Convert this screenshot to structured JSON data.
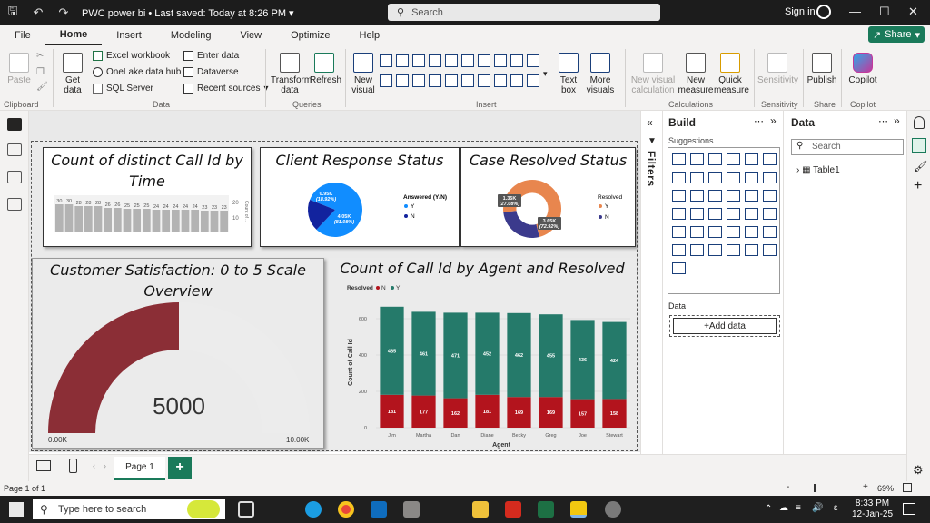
{
  "titlebar": {
    "app_title": "PWC power bi",
    "save_status": "Last saved: Today at 8:26 PM",
    "search_placeholder": "Search",
    "sign_in": "Sign in"
  },
  "menu": {
    "tabs": [
      "File",
      "Home",
      "Insert",
      "Modeling",
      "View",
      "Optimize",
      "Help"
    ],
    "active": "Home",
    "share_label": "Share"
  },
  "ribbon": {
    "paste": "Paste",
    "get_data": "Get data",
    "excel_workbook": "Excel workbook",
    "onelake": "OneLake data hub",
    "sql_server": "SQL Server",
    "enter_data": "Enter data",
    "dataverse": "Dataverse",
    "recent_sources": "Recent sources",
    "transform_data": "Transform data",
    "refresh": "Refresh",
    "new_visual": "New visual",
    "text_box": "Text box",
    "more_visuals": "More visuals",
    "new_visual_calc": "New visual calculation",
    "new_measure": "New measure",
    "quick_measure": "Quick measure",
    "sensitivity": "Sensitivity",
    "publish": "Publish",
    "copilot": "Copilot",
    "groups": {
      "clipboard": "Clipboard",
      "data": "Data",
      "queries": "Queries",
      "insert": "Insert",
      "calculations": "Calculations",
      "sensitivity": "Sensitivity",
      "share": "Share",
      "copilot": "Copilot"
    }
  },
  "visuals": {
    "time_chart": {
      "title": "Count of distinct Call Id by Time",
      "y_axis_label": "Count of ...",
      "y_max_label": "20",
      "y_min_label": "10"
    },
    "client_response": {
      "title": "Client Response Status",
      "legend_title": "Answered (Y/N)",
      "legend_items": [
        "Y",
        "N"
      ]
    },
    "case_resolved": {
      "title": "Case Resolved Status",
      "legend_title": "Resolved",
      "legend_items": [
        "Y",
        "N"
      ]
    },
    "satisfaction": {
      "title": "Customer Satisfaction: 0 to 5 Scale Overview",
      "value": "5000",
      "min_label": "0.00K",
      "max_label": "10.00K"
    },
    "agent_chart": {
      "title": "Count of Call Id by Agent and Resolved",
      "legend_title": "Resolved",
      "legend_items": [
        "N",
        "Y"
      ],
      "x_label": "Agent",
      "y_label": "Count of Call Id"
    }
  },
  "chart_data": [
    {
      "type": "bar",
      "title": "Count of distinct Call Id by Time",
      "values": [
        30,
        30,
        28,
        28,
        28,
        26,
        26,
        25,
        25,
        25,
        24,
        24,
        24,
        24,
        24,
        23,
        23,
        23
      ],
      "color": "#b3b3b3"
    },
    {
      "type": "pie",
      "title": "Client Response Status",
      "slices": [
        {
          "name": "Y",
          "value": 4.05,
          "label": "4.05K",
          "pct_label": "(81.08%)",
          "color": "#118dff"
        },
        {
          "name": "N",
          "value": 0.95,
          "label": "0.95K",
          "pct_label": "(18.92%)",
          "color": "#12239e"
        }
      ]
    },
    {
      "type": "pie",
      "title": "Case Resolved Status",
      "slices": [
        {
          "name": "Y",
          "value": 3.65,
          "label": "3.65K",
          "pct_label": "(72.92%)",
          "color": "#e8864e"
        },
        {
          "name": "N",
          "value": 1.35,
          "label": "1.35K",
          "pct_label": "(27.08%)",
          "color": "#3b3a8c"
        }
      ]
    },
    {
      "type": "bar",
      "title": "Count of Call Id by Agent and Resolved",
      "categories": [
        "Jim",
        "Martha",
        "Dan",
        "Diane",
        "Becky",
        "Greg",
        "Joe",
        "Stewart"
      ],
      "series": [
        {
          "name": "N",
          "values": [
            181,
            177,
            162,
            181,
            169,
            169,
            157,
            158
          ],
          "color": "#b3141d"
        },
        {
          "name": "Y",
          "values": [
            485,
            461,
            471,
            452,
            462,
            455,
            436,
            424
          ],
          "color": "#257a6a"
        }
      ],
      "xlabel": "Agent",
      "ylabel": "Count of Call Id",
      "ylim": [
        0,
        700
      ],
      "y_ticks": [
        0,
        200,
        400,
        600
      ]
    },
    {
      "type": "gauge",
      "title": "Customer Satisfaction: 0 to 5 Scale Overview",
      "value": 5000,
      "min": 0,
      "max": 10000,
      "fill_color": "#8b2e36",
      "track_color": "#ececec"
    }
  ],
  "filters_pane": {
    "label": "Filters"
  },
  "build_pane": {
    "title": "Build",
    "suggestions": "Suggestions",
    "data_label": "Data",
    "add_data": "+Add data"
  },
  "data_pane": {
    "title": "Data",
    "search_placeholder": "Search",
    "table": "Table1"
  },
  "page_tabs": {
    "page1": "Page 1"
  },
  "statusbar": {
    "page_info": "Page 1 of 1",
    "zoom": "69%"
  },
  "taskbar": {
    "search_placeholder": "Type here to search",
    "time": "8:33 PM",
    "date": "12-Jan-25",
    "lang": "ε"
  }
}
